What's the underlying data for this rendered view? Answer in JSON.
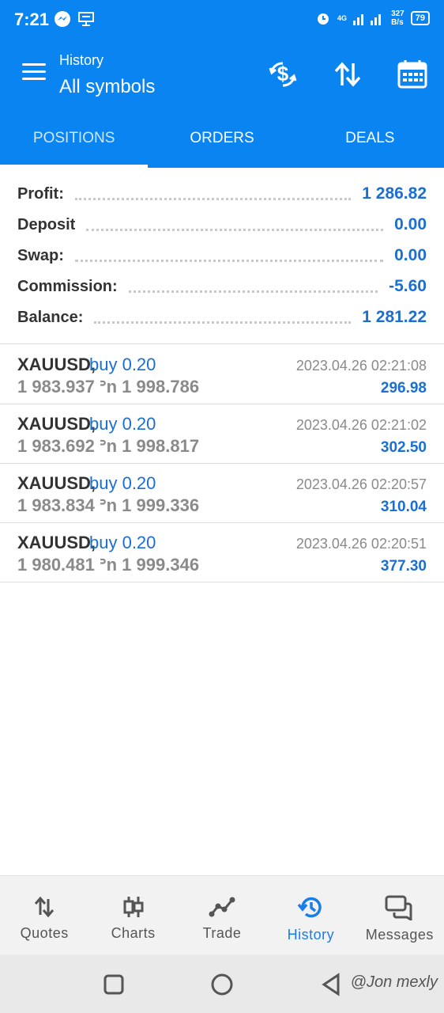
{
  "status": {
    "time": "7:21",
    "net_label": "4G",
    "net_speed_value": "327",
    "net_speed_unit": "B/s",
    "battery": "79"
  },
  "appbar": {
    "subtitle": "History",
    "title": "All symbols"
  },
  "tabs": [
    {
      "label": "POSITIONS",
      "active": true
    },
    {
      "label": "ORDERS",
      "active": false
    },
    {
      "label": "DEALS",
      "active": false
    }
  ],
  "summary": {
    "profit": {
      "label": "Profit:",
      "value": "1 286.82"
    },
    "deposit": {
      "label": "Deposit",
      "value": "0.00"
    },
    "swap": {
      "label": "Swap:",
      "value": "0.00"
    },
    "commission": {
      "label": "Commission:",
      "value": "-5.60"
    },
    "balance": {
      "label": "Balance:",
      "value": "1 281.22"
    }
  },
  "deals": [
    {
      "symbol": "XAUUSD,",
      "type": "buy 0.20",
      "prices": "1 983.937 ᐣn  1 998.786",
      "time": "2023.04.26 02:21:08",
      "profit": "296.98"
    },
    {
      "symbol": "XAUUSD,",
      "type": "buy 0.20",
      "prices": "1 983.692 ᐣn  1 998.817",
      "time": "2023.04.26 02:21:02",
      "profit": "302.50"
    },
    {
      "symbol": "XAUUSD,",
      "type": "buy 0.20",
      "prices": "1 983.834 ᐣn  1 999.336",
      "time": "2023.04.26 02:20:57",
      "profit": "310.04"
    },
    {
      "symbol": "XAUUSD,",
      "type": "buy 0.20",
      "prices": "1 980.481 ᐣn  1 999.346",
      "time": "2023.04.26 02:20:51",
      "profit": "377.30"
    }
  ],
  "bottom_nav": [
    {
      "label": "Quotes",
      "icon": "quotes-icon"
    },
    {
      "label": "Charts",
      "icon": "charts-icon"
    },
    {
      "label": "Trade",
      "icon": "trade-icon"
    },
    {
      "label": "History",
      "icon": "history-icon",
      "active": true
    },
    {
      "label": "Messages",
      "icon": "messages-icon"
    }
  ],
  "watermark": "@Jon mexly",
  "colors": {
    "accent": "#0a84f0",
    "value_blue": "#1a6fd0",
    "active_nav": "#1a7ee8"
  }
}
